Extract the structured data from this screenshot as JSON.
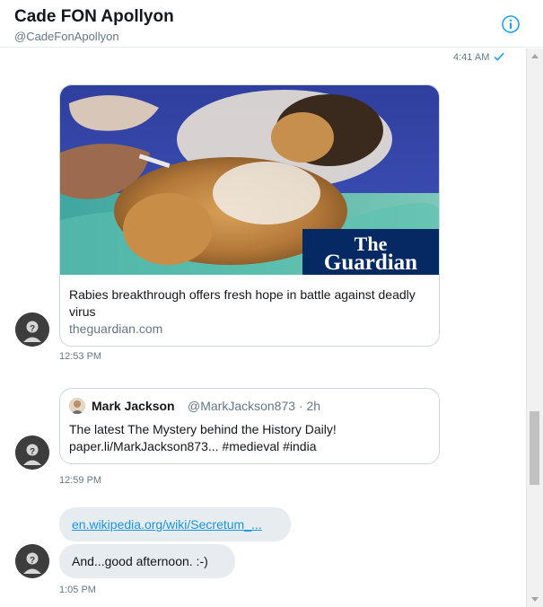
{
  "header": {
    "name": "Cade FON Apollyon",
    "handle": "@CadeFonApollyon",
    "info_icon": "info-icon"
  },
  "messages": [
    {
      "time": "4:41 AM",
      "read_icon": "check-icon"
    },
    {
      "card": {
        "title": "Rabies breakthrough offers fresh hope in battle against deadly virus",
        "domain": "theguardian.com",
        "logo_line1": "The",
        "logo_line2": "Guardian"
      },
      "time": "12:53 PM"
    },
    {
      "quote": {
        "name": "Mark Jackson",
        "handle": "@MarkJackson873 · 2h",
        "text": "The latest The Mystery behind the History Daily! paper.li/MarkJackson873... #medieval #india"
      },
      "time": "12:59 PM"
    },
    {
      "link": "en.wikipedia.org/wiki/Secretum_...",
      "text": "And...good afternoon. :-)",
      "time": "1:05 PM"
    }
  ],
  "colors": {
    "accent": "#1da1f2",
    "bubble": "#e6ecf0",
    "secondary_text": "#657786",
    "guardian_blue": "#052962"
  }
}
